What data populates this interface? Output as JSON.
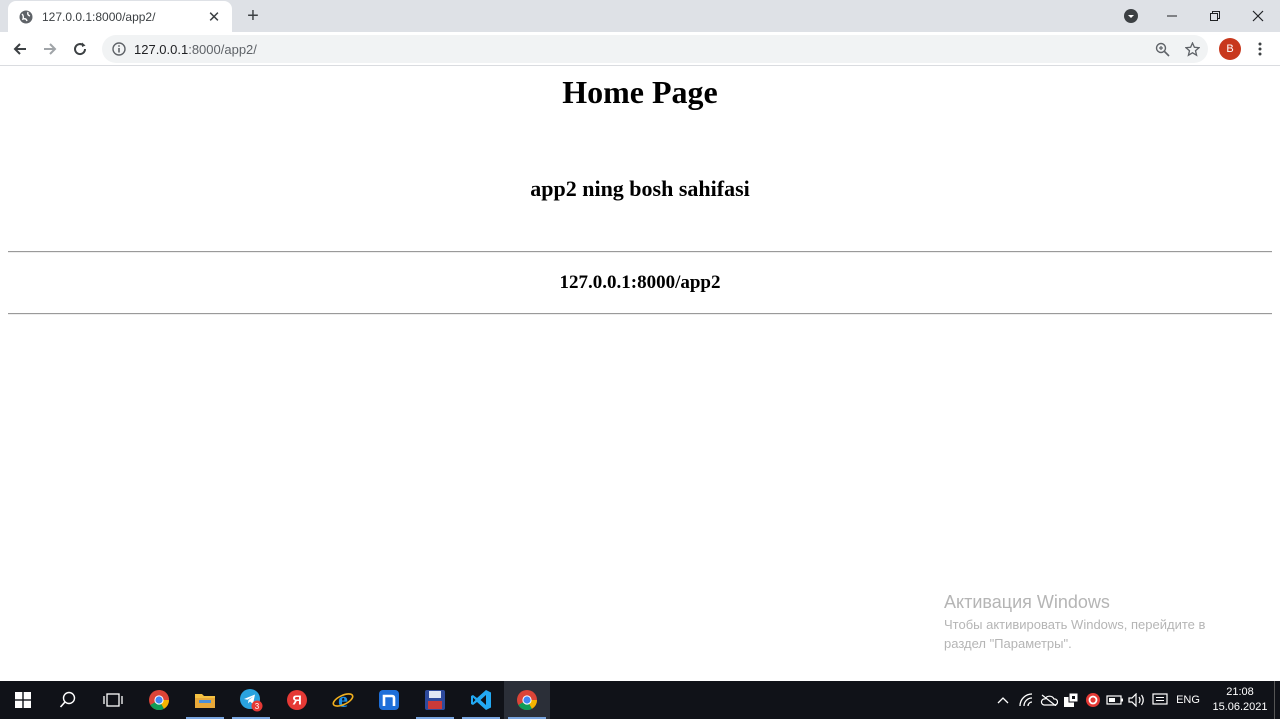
{
  "browser": {
    "tab_title": "127.0.0.1:8000/app2/",
    "url_host": "127.0.0.1",
    "url_rest": ":8000/app2/",
    "profile_initial": "B"
  },
  "page": {
    "heading": "Home Page",
    "subheading": "app2 ning bosh sahifasi",
    "url_text": "127.0.0.1:8000/app2"
  },
  "watermark": {
    "title": "Активация Windows",
    "text": "Чтобы активировать Windows, перейдите в раздел \"Параметры\"."
  },
  "taskbar": {
    "telegram_badge": "3",
    "yandex_letter": "Я",
    "language": "ENG",
    "time": "21:08",
    "date": "15.06.2021"
  },
  "colors": {
    "tabstrip": "#dee1e6",
    "taskbar": "#101218",
    "avatar": "#c8381d",
    "watermark": "#b5b5b5"
  }
}
